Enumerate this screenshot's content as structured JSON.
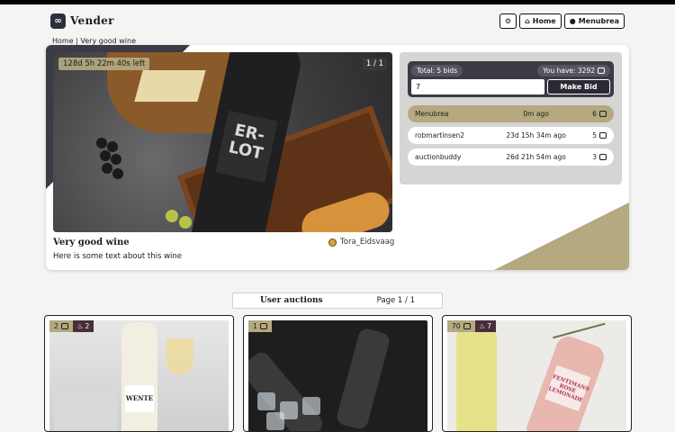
{
  "brand": {
    "name": "Vender",
    "logo": "link-logo-icon"
  },
  "nav": {
    "settings_icon": "gear-icon",
    "home_label": "Home",
    "home_icon": "house-icon",
    "user_label": "Menubrea",
    "user_icon": "person-icon"
  },
  "breadcrumb": "Home | Very good wine",
  "auction": {
    "time_left": "128d 5h 22m 40s left",
    "image_counter": "1 / 1",
    "title": "Very good wine",
    "description": "Here is some text about this wine",
    "seller": "Tora_Eidsvaag",
    "bottle_text": "ER-\nLOT"
  },
  "bidding": {
    "total_bids": "Total: 5 bids",
    "you_have": "You have: 3292",
    "input_value": "7",
    "make_bid_label": "Make Bid",
    "bids": [
      {
        "user": "Menubrea",
        "time": "0m ago",
        "amount": "6",
        "active": true
      },
      {
        "user": "robmartinsen2",
        "time": "23d 15h 34m ago",
        "amount": "5",
        "active": false
      },
      {
        "user": "auctionbuddy",
        "time": "26d 21h 54m ago",
        "amount": "3",
        "active": false
      }
    ]
  },
  "user_auctions": {
    "title": "User auctions",
    "page": "Page 1 / 1",
    "cards": [
      {
        "bids": "2",
        "hot": "2",
        "wine_label": "WENTE"
      },
      {
        "bids": "1",
        "hot": null
      },
      {
        "bids": "70",
        "hot": "7",
        "wine_label": "FENTIMANS ROSE LEMONADE"
      }
    ]
  },
  "colors": {
    "accent_gold": "#b4a97f",
    "dark": "#3b3a45",
    "hot_badge": "#4a2d3a"
  }
}
